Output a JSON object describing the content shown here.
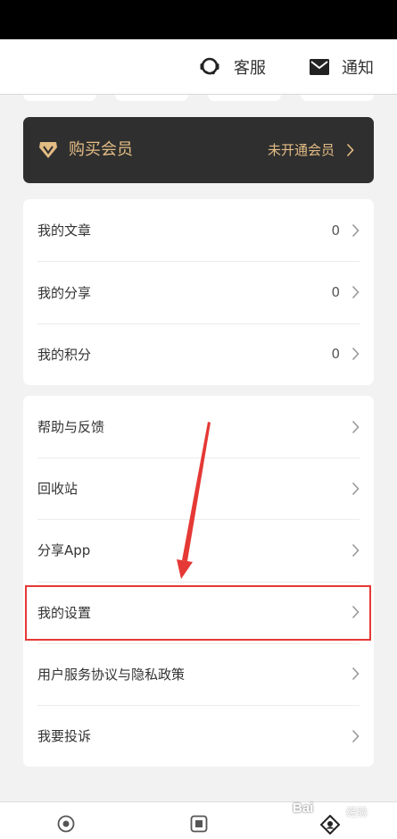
{
  "header": {
    "customer_service_label": "客服",
    "notification_label": "通知"
  },
  "vip": {
    "title": "购买会员",
    "status": "未开通会员"
  },
  "stats": [
    {
      "label": "我的文章",
      "value": "0"
    },
    {
      "label": "我的分享",
      "value": "0"
    },
    {
      "label": "我的积分",
      "value": "0"
    }
  ],
  "menu": [
    {
      "label": "帮助与反馈"
    },
    {
      "label": "回收站"
    },
    {
      "label": "分享App"
    },
    {
      "label": "我的设置"
    },
    {
      "label": "用户服务协议与隐私政策"
    },
    {
      "label": "我要投诉"
    }
  ],
  "watermark": {
    "brand": "Bai",
    "sub": "经验"
  },
  "colors": {
    "vip_background": "#2f2f2f",
    "vip_gold": "#e3bc84",
    "highlight": "#e53935"
  }
}
